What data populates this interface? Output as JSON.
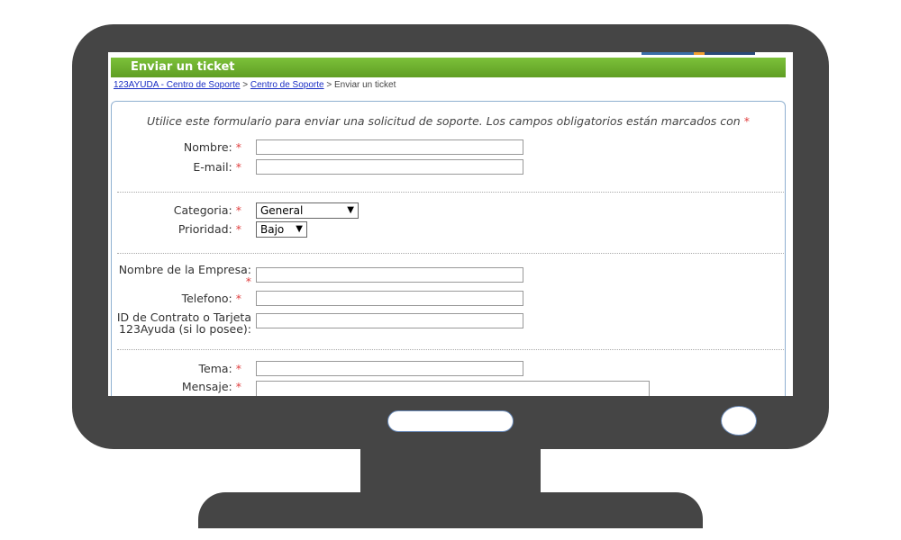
{
  "header": {
    "title": "Enviar un ticket"
  },
  "breadcrumb": {
    "link1": "123AYUDA - Centro de Soporte",
    "sep1": " > ",
    "link2": "Centro de Soporte",
    "sep2": " > ",
    "current": "Enviar un ticket"
  },
  "form": {
    "intro": "Utilice este formulario para enviar una solicitud de soporte. Los campos obligatorios están marcados con",
    "required_mark": "*",
    "name_label": "Nombre:",
    "email_label": "E-mail:",
    "category_label": "Categoria:",
    "category_value": "General",
    "priority_label": "Prioridad:",
    "priority_value": "Bajo",
    "company_label": "Nombre de la Empresa:",
    "phone_label": "Telefono:",
    "contract_label_line1": "ID de Contrato o Tarjeta",
    "contract_label_line2": "123Ayuda (si lo posee):",
    "subject_label": "Tema:",
    "message_label": "Mensaje:"
  },
  "colors": {
    "header_green": "#6aaf2c",
    "link_blue": "#1a2ec4",
    "required_red": "#e04040",
    "monitor_gray": "#454545"
  }
}
